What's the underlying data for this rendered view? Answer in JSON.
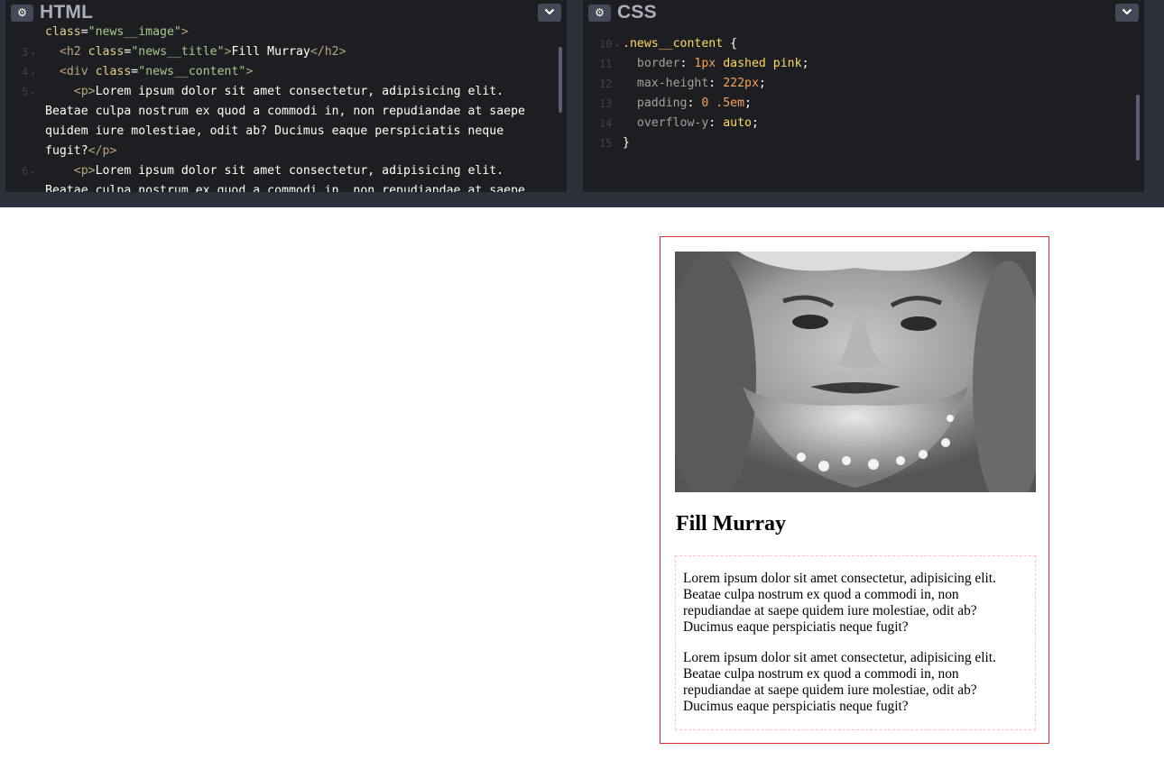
{
  "html_panel": {
    "title": "HTML",
    "gear_icon": "gear-icon",
    "chevron_icon": "chevron-down-icon",
    "lines": [
      {
        "num": "",
        "fold": false,
        "parts": [
          [
            "attr",
            "class"
          ],
          [
            "txt",
            "="
          ],
          [
            "str",
            "\"news__image\""
          ],
          [
            "tag",
            ">"
          ]
        ],
        "indent": ""
      },
      {
        "num": "3",
        "fold": true,
        "parts": [
          [
            "tag",
            "<h2 "
          ],
          [
            "attr",
            "class"
          ],
          [
            "txt",
            "="
          ],
          [
            "str",
            "\"news__title\""
          ],
          [
            "tag",
            ">"
          ],
          [
            "txt",
            "Fill Murray"
          ],
          [
            "tag",
            "</h2>"
          ]
        ],
        "indent": "  "
      },
      {
        "num": "4",
        "fold": true,
        "parts": [
          [
            "tag",
            "<div "
          ],
          [
            "attr",
            "class"
          ],
          [
            "txt",
            "="
          ],
          [
            "str",
            "\"news__content\""
          ],
          [
            "tag",
            ">"
          ]
        ],
        "indent": "  "
      },
      {
        "num": "5",
        "fold": true,
        "parts": [
          [
            "tag",
            "<p>"
          ],
          [
            "txt",
            "Lorem ipsum dolor sit amet consectetur, adipisicing elit."
          ]
        ],
        "indent": "    "
      },
      {
        "num": "",
        "fold": false,
        "parts": [
          [
            "txt",
            "Beatae culpa nostrum ex quod a commodi in, non repudiandae at saepe"
          ]
        ],
        "indent": ""
      },
      {
        "num": "",
        "fold": false,
        "parts": [
          [
            "txt",
            "quidem iure molestiae, odit ab? Ducimus eaque perspiciatis neque"
          ]
        ],
        "indent": ""
      },
      {
        "num": "",
        "fold": false,
        "parts": [
          [
            "txt",
            "fugit?"
          ],
          [
            "tag",
            "</p>"
          ]
        ],
        "indent": ""
      },
      {
        "num": "6",
        "fold": true,
        "parts": [
          [
            "tag",
            "<p>"
          ],
          [
            "txt",
            "Lorem ipsum dolor sit amet consectetur, adipisicing elit."
          ]
        ],
        "indent": "    "
      },
      {
        "num": "",
        "fold": false,
        "parts": [
          [
            "txt",
            "Beatae culpa nostrum ex quod a commodi in, non repudiandae at saepe"
          ]
        ],
        "indent": ""
      }
    ]
  },
  "css_panel": {
    "title": "CSS",
    "gear_icon": "gear-icon",
    "chevron_icon": "chevron-down-icon",
    "lines": [
      {
        "num": "10",
        "fold": true,
        "parts": [
          [
            "sel",
            ".news__content"
          ],
          [
            "txt",
            " {"
          ]
        ],
        "indent": ""
      },
      {
        "num": "11",
        "fold": false,
        "parts": [
          [
            "prop",
            "border"
          ],
          [
            "txt",
            ": "
          ],
          [
            "num",
            "1px"
          ],
          [
            "txt",
            " "
          ],
          [
            "kw",
            "dashed"
          ],
          [
            "txt",
            " "
          ],
          [
            "kw",
            "pink"
          ],
          [
            "txt",
            ";"
          ]
        ],
        "indent": "  "
      },
      {
        "num": "12",
        "fold": false,
        "parts": [
          [
            "prop",
            "max-height"
          ],
          [
            "txt",
            ": "
          ],
          [
            "num",
            "222px"
          ],
          [
            "txt",
            ";"
          ]
        ],
        "indent": "  "
      },
      {
        "num": "13",
        "fold": false,
        "parts": [
          [
            "prop",
            "padding"
          ],
          [
            "txt",
            ": "
          ],
          [
            "num",
            "0"
          ],
          [
            "txt",
            " "
          ],
          [
            "num",
            ".5em"
          ],
          [
            "txt",
            ";"
          ]
        ],
        "indent": "  "
      },
      {
        "num": "14",
        "fold": false,
        "parts": [
          [
            "prop",
            "overflow-y"
          ],
          [
            "txt",
            ": "
          ],
          [
            "kw",
            "auto"
          ],
          [
            "txt",
            ";"
          ]
        ],
        "indent": "  "
      },
      {
        "num": "15",
        "fold": false,
        "parts": [
          [
            "txt",
            "}"
          ]
        ],
        "indent": ""
      }
    ]
  },
  "preview": {
    "image_alt": "Fill Murray",
    "title": "Fill Murray",
    "paragraphs": [
      "Lorem ipsum dolor sit amet consectetur, adipisicing elit. Beatae culpa nostrum ex quod a commodi in, non repudiandae at saepe quidem iure molestiae, odit ab? Ducimus eaque perspiciatis neque fugit?",
      "Lorem ipsum dolor sit amet consectetur, adipisicing elit. Beatae culpa nostrum ex quod a commodi in, non repudiandae at saepe quidem iure molestiae, odit ab? Ducimus eaque perspiciatis neque fugit?"
    ]
  },
  "colors": {
    "editor_bg": "#1d1e22",
    "editor_chrome": "#2c303a",
    "card_border": "#d32f2f",
    "content_border": "pink"
  }
}
